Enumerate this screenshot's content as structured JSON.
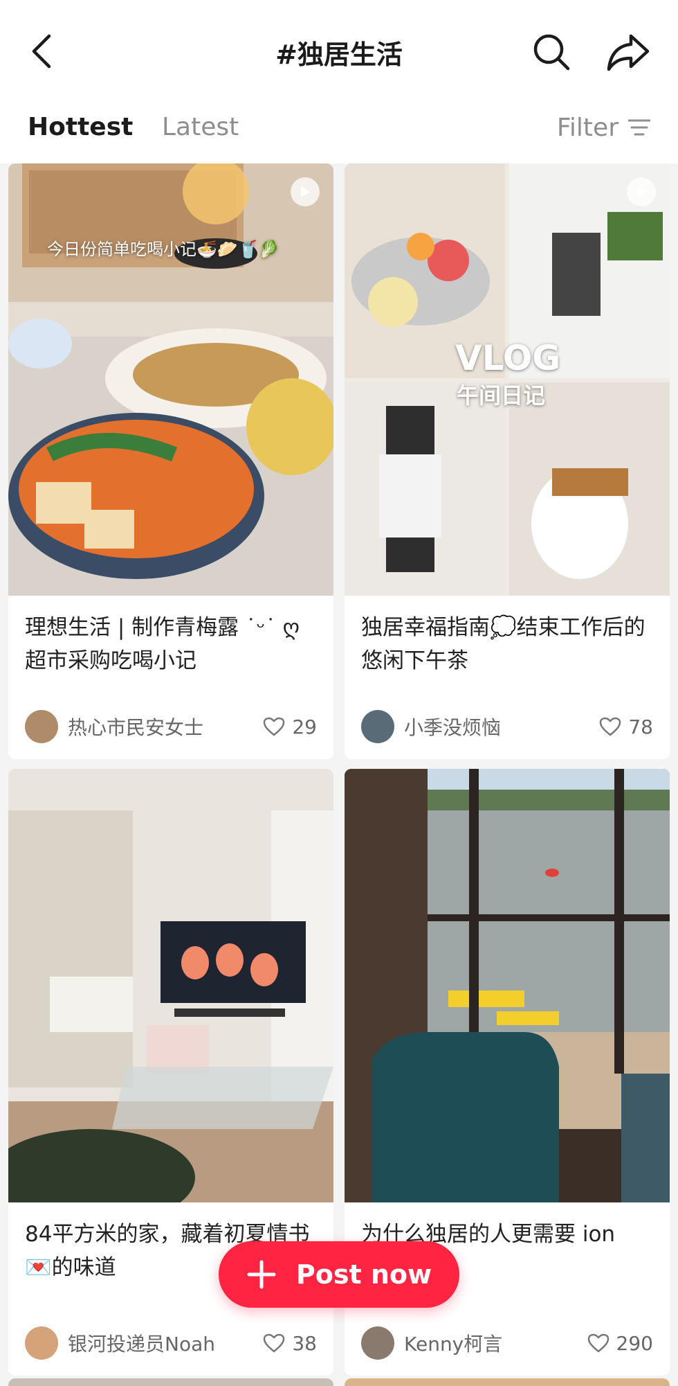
{
  "header": {
    "title": "#独居生活"
  },
  "tabs": {
    "hottest": "Hottest",
    "latest": "Latest",
    "filter": "Filter"
  },
  "cards": [
    {
      "title": "理想生活 | 制作青梅露 ˙ᵕ˙ ღ 超市采购吃喝小记",
      "overlay": "今日份简单吃喝小记🍜🥟🥤🥬",
      "author": "热心市民安女士",
      "likes": "29"
    },
    {
      "title": "独居幸福指南💭结束工作后的悠闲下午茶",
      "overlay_big": "VLOG",
      "overlay_small": "午间日记",
      "author": "小季没烦恼",
      "likes": "78"
    },
    {
      "title": "84平方米的家，藏着初夏情书💌的味道",
      "author": "银河投递员Noah",
      "likes": "38"
    },
    {
      "title": "为什么独居的人更需要 ion",
      "author": "Kenny柯言",
      "likes": "290"
    }
  ],
  "post_button": {
    "label": "Post now"
  },
  "colors": {
    "accent": "#ff2442"
  }
}
